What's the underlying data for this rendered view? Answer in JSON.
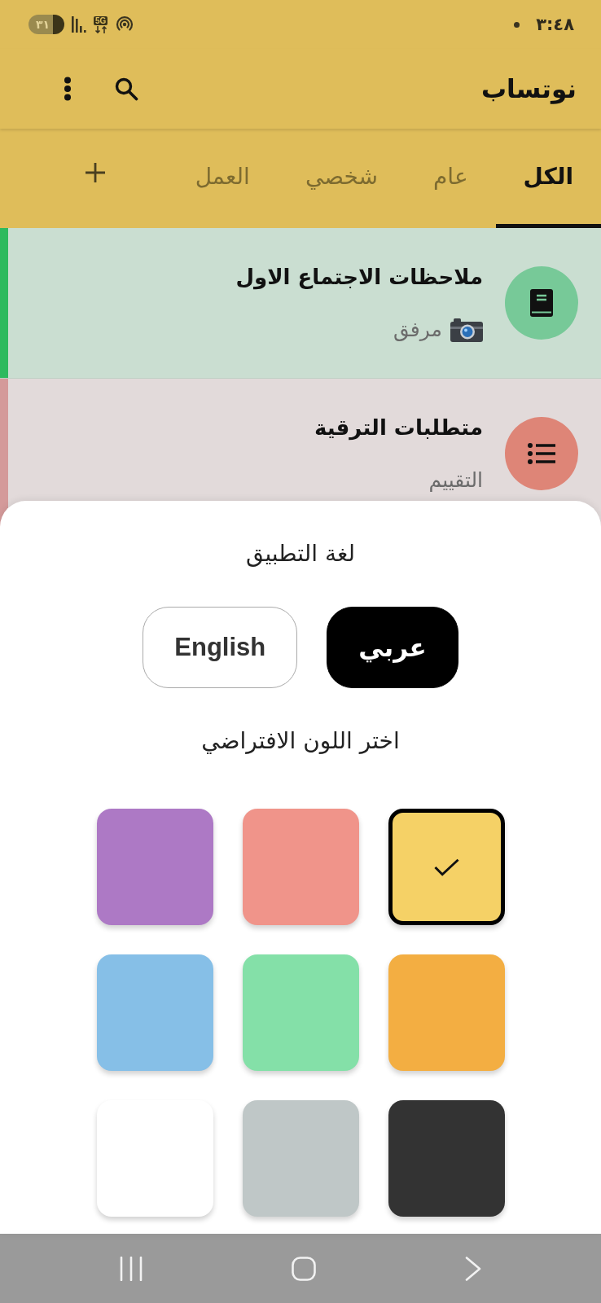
{
  "status_bar": {
    "time": "٣:٤٨",
    "network": "5G",
    "battery": "٣١"
  },
  "app_bar": {
    "title": "نوتساب"
  },
  "tabs": [
    {
      "label": "الكل",
      "selected": true
    },
    {
      "label": "عام",
      "selected": false
    },
    {
      "label": "شخصي",
      "selected": false
    },
    {
      "label": "العمل",
      "selected": false
    }
  ],
  "notes": [
    {
      "title": "ملاحظات الاجتماع الاول",
      "subtitle": "مرفق",
      "attachment": true,
      "color": "#2dba5e",
      "icon": {
        "kind": "notebook",
        "color": "#77c998"
      }
    },
    {
      "title": "متطلبات الترقية",
      "subtitle": "التقييم",
      "attachment": false,
      "color": "#d49a9a",
      "icon": {
        "kind": "checklist",
        "color": "#de8577"
      }
    }
  ],
  "settings_sheet": {
    "language_title": "لغة التطبيق",
    "languages": [
      {
        "label": "عربي",
        "selected": true
      },
      {
        "label": "English",
        "selected": false
      }
    ],
    "color_title": "اختر اللون الافتراضي",
    "swatches": [
      {
        "color": "#f5d166",
        "selected": true
      },
      {
        "color": "#f0948a",
        "selected": false
      },
      {
        "color": "#ad79c5",
        "selected": false
      },
      {
        "color": "#f3ae42",
        "selected": false
      },
      {
        "color": "#84e0a8",
        "selected": false
      },
      {
        "color": "#86bfe7",
        "selected": false
      },
      {
        "color": "#333333",
        "selected": false
      },
      {
        "color": "#bfc7c7",
        "selected": false
      },
      {
        "color": "#ffffff",
        "selected": false
      }
    ]
  }
}
